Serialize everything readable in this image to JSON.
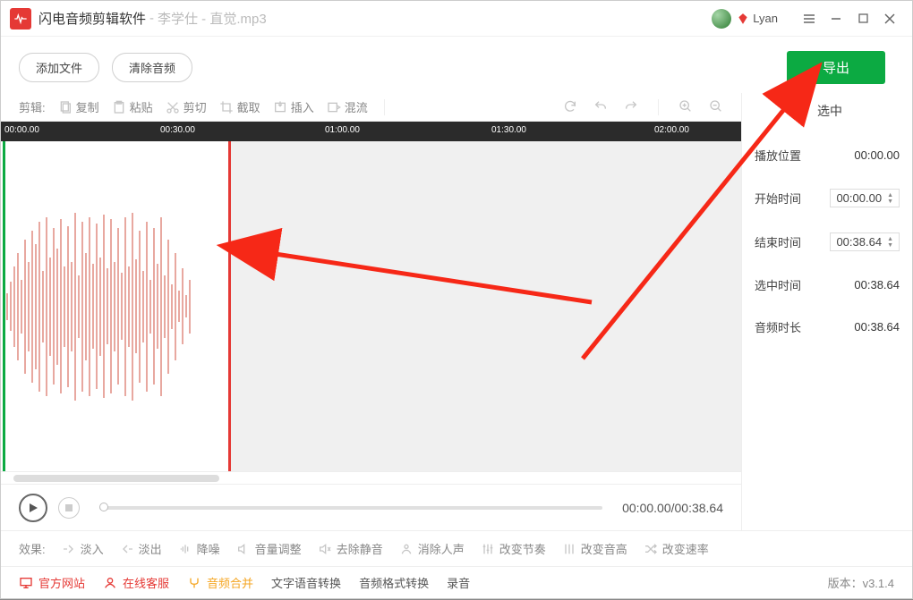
{
  "titlebar": {
    "app_name": "闪电音频剪辑软件",
    "sep": " - ",
    "file": "李学仕 - 直觉.mp3",
    "username": "Lyan"
  },
  "top": {
    "add_file": "添加文件",
    "clear_audio": "清除音频",
    "export": "导出"
  },
  "edit": {
    "label": "剪辑:",
    "copy": "复制",
    "paste": "粘贴",
    "cut": "剪切",
    "crop": "截取",
    "insert": "插入",
    "mix": "混流"
  },
  "ruler": {
    "t0": "00:00.00",
    "t1": "00:30.00",
    "t2": "01:00.00",
    "t3": "01:30.00",
    "t4": "02:00.00"
  },
  "player": {
    "time": "00:00.00/00:38.64"
  },
  "sidebar": {
    "selected": "选中",
    "play_pos_label": "播放位置",
    "play_pos": "00:00.00",
    "start_label": "开始时间",
    "start": "00:00.00",
    "end_label": "结束时间",
    "end": "00:38.64",
    "sel_dur_label": "选中时间",
    "sel_dur": "00:38.64",
    "total_label": "音频时长",
    "total": "00:38.64"
  },
  "effects": {
    "label": "效果:",
    "fade_in": "淡入",
    "fade_out": "淡出",
    "denoise": "降噪",
    "volume": "音量调整",
    "rm_silence": "去除静音",
    "rm_vocal": "消除人声",
    "tempo": "改变节奏",
    "pitch": "改变音高",
    "speed": "改变速率"
  },
  "bottom": {
    "website": "官方网站",
    "service": "在线客服",
    "merge": "音频合并",
    "tts": "文字语音转换",
    "format": "音频格式转换",
    "record": "录音",
    "version_label": "版本：",
    "version": "v3.1.4"
  }
}
